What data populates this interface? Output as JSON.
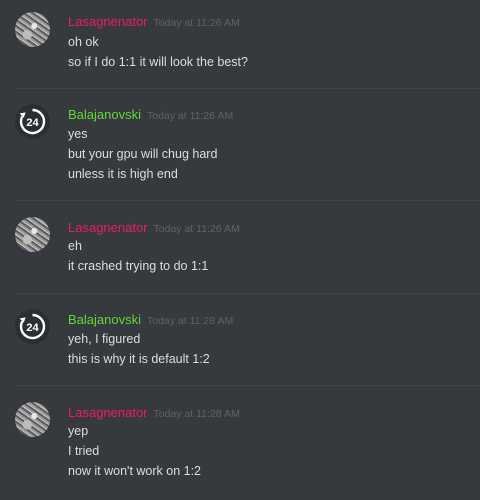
{
  "colors": {
    "background": "#36393e",
    "lasagnenator": "#e91e63",
    "balajanovski": "#60d936",
    "text": "#dcddde",
    "timestamp": "#5f6268"
  },
  "messages": [
    {
      "author": "Lasagnenator",
      "timestamp": "Today at 11:26 AM",
      "avatar": "grayscale-photo-avatar",
      "lines": [
        "oh ok",
        "so if I do 1:1 it will look the best?"
      ]
    },
    {
      "author": "Balajanovski",
      "timestamp": "Today at 11:26 AM",
      "avatar": "24-clock-icon",
      "lines": [
        "yes",
        "but your gpu will chug hard",
        "unless it is high end"
      ]
    },
    {
      "author": "Lasagnenator",
      "timestamp": "Today at 11:26 AM",
      "avatar": "grayscale-photo-avatar",
      "lines": [
        "eh",
        "it crashed trying to do 1:1"
      ]
    },
    {
      "author": "Balajanovski",
      "timestamp": "Today at 11:28 AM",
      "avatar": "24-clock-icon",
      "lines": [
        "yeh, I figured",
        "this is why it is default 1:2"
      ]
    },
    {
      "author": "Lasagnenator",
      "timestamp": "Today at 11:28 AM",
      "avatar": "grayscale-photo-avatar",
      "lines": [
        "yep",
        "I tried",
        "now it won't work on 1:2"
      ]
    }
  ]
}
